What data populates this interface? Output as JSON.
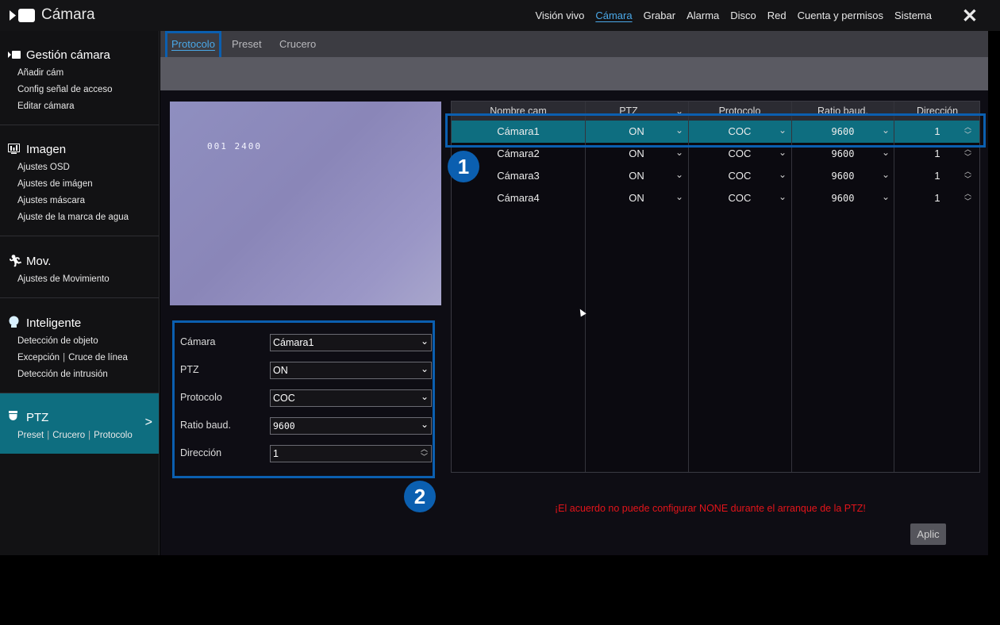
{
  "app": {
    "title": "Cámara",
    "icon": "camera-icon"
  },
  "nav": [
    "Visión vivo",
    "Cámara",
    "Grabar",
    "Alarma",
    "Disco",
    "Red",
    "Cuenta y permisos",
    "Sistema"
  ],
  "nav_active": "Cámara",
  "close_icon": "close-icon",
  "sidebar": {
    "groups": [
      {
        "title": "Gestión cámara",
        "icon": "camera-icon",
        "items": [
          "Añadir cám",
          "Config señal de acceso",
          "Editar cámara"
        ]
      },
      {
        "title": "Imagen",
        "icon": "image-icon",
        "items": [
          "Ajustes OSD",
          "Ajustes de imágen",
          "Ajustes máscara",
          "Ajuste de la marca de agua"
        ]
      },
      {
        "title": "Mov.",
        "icon": "motion-icon",
        "items": [
          "Ajustes de Movimiento"
        ]
      },
      {
        "title": "Inteligente",
        "icon": "intelligent-icon",
        "items": [
          "Detección de objeto",
          "Excepción",
          "Cruce de línea",
          "Detección de intrusión"
        ]
      },
      {
        "title": "PTZ",
        "icon": "ptz-icon",
        "items": [
          "Preset",
          "Crucero",
          "Protocolo"
        ]
      }
    ],
    "active_group": "PTZ"
  },
  "tabs": [
    "Protocolo",
    "Preset",
    "Crucero"
  ],
  "tab_active": "Protocolo",
  "preview": {
    "osd_text": "001 2400"
  },
  "form": {
    "camera_label": "Cámara",
    "camera_value": "Cámara1",
    "ptz_label": "PTZ",
    "ptz_value": "ON",
    "protocol_label": "Protocolo",
    "protocol_value": "COC",
    "baud_label": "Ratio baud.",
    "baud_value": "9600",
    "address_label": "Dirección",
    "address_value": "1"
  },
  "table": {
    "headers": [
      "Nombre cam",
      "PTZ",
      "Protocolo",
      "Ratio baud.",
      "Dirección"
    ],
    "rows": [
      {
        "name": "Cámara1",
        "ptz": "ON",
        "protocol": "COC",
        "baud": "9600",
        "address": "1"
      },
      {
        "name": "Cámara2",
        "ptz": "ON",
        "protocol": "COC",
        "baud": "9600",
        "address": "1"
      },
      {
        "name": "Cámara3",
        "ptz": "ON",
        "protocol": "COC",
        "baud": "9600",
        "address": "1"
      },
      {
        "name": "Cámara4",
        "ptz": "ON",
        "protocol": "COC",
        "baud": "9600",
        "address": "1"
      }
    ],
    "selected_row": 0
  },
  "callouts": {
    "one": "1",
    "two": "2"
  },
  "warning": "¡El acuerdo no puede configurar NONE durante el arranque de la PTZ!",
  "apply_label": "Aplic",
  "colors": {
    "accent": "#0e6e80",
    "highlight_border": "#0b5fb0",
    "link": "#4aa8e8",
    "warning": "#e4141a"
  }
}
